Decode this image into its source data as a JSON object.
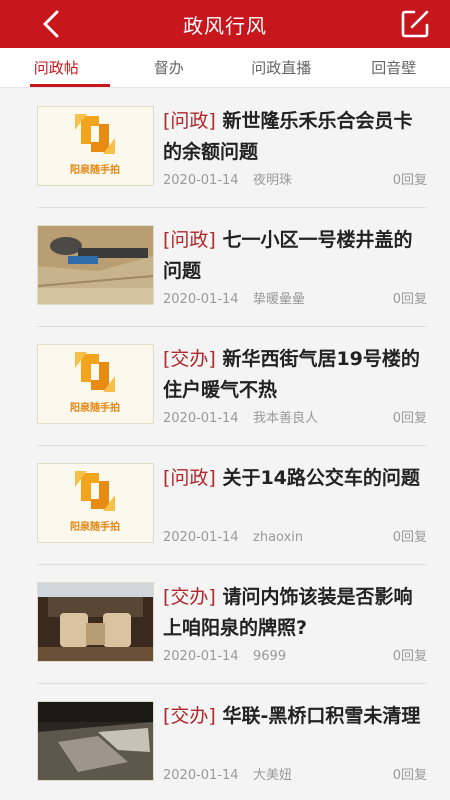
{
  "header": {
    "title": "政风行风",
    "back_icon": "chevron-left-icon",
    "edit_icon": "compose-icon",
    "color": "#c8161d"
  },
  "tabs": [
    {
      "label": "问政帖",
      "active": true
    },
    {
      "label": "督办",
      "active": false
    },
    {
      "label": "问政直播",
      "active": false
    },
    {
      "label": "回音壁",
      "active": false
    }
  ],
  "posts": [
    {
      "tag": "[问政]",
      "title": "新世隆乐禾乐合会员卡的余额问题",
      "date": "2020-01-14",
      "author": "夜明珠",
      "replies": "0回复",
      "thumb": "logo",
      "logo_text": "阳泉随手拍"
    },
    {
      "tag": "[问政]",
      "title": "七一小区一号楼井盖的问题",
      "date": "2020-01-14",
      "author": "挚暖曐曐",
      "replies": "0回复",
      "thumb": "photo-manhole"
    },
    {
      "tag": "[交办]",
      "title": "新华西街气居19号楼的住户暖气不热",
      "date": "2020-01-14",
      "author": "我本善良人",
      "replies": "0回复",
      "thumb": "logo",
      "logo_text": "阳泉随手拍"
    },
    {
      "tag": "[问政]",
      "title": "关于14路公交车的问题",
      "date": "2020-01-14",
      "author": "zhaoxin",
      "replies": "0回复",
      "thumb": "logo",
      "logo_text": "阳泉随手拍"
    },
    {
      "tag": "[交办]",
      "title": "请问内饰该装是否影响上咱阳泉的牌照?",
      "date": "2020-01-14",
      "author": "9699",
      "replies": "0回复",
      "thumb": "photo-car-interior"
    },
    {
      "tag": "[交办]",
      "title": "华联-黑桥口积雪未清理",
      "date": "2020-01-14",
      "author": "大美妞",
      "replies": "0回复",
      "thumb": "photo-snow-road"
    }
  ]
}
